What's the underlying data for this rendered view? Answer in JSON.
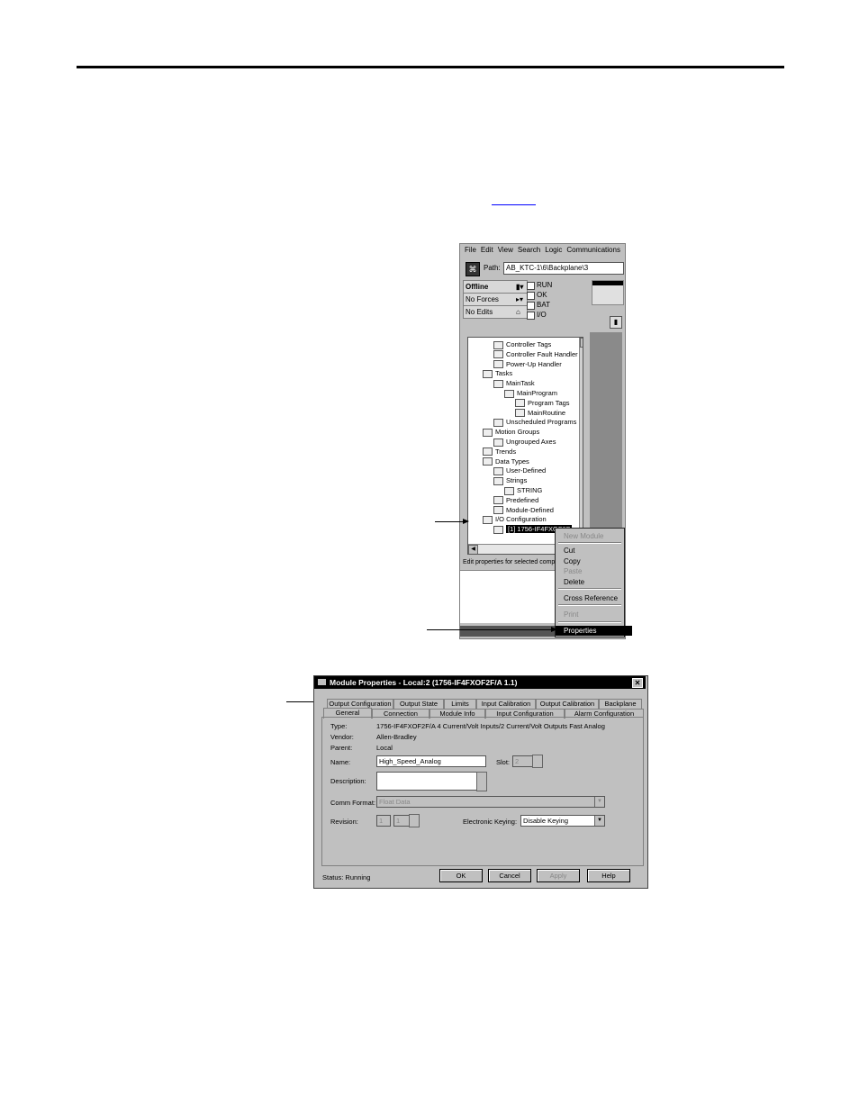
{
  "organizer": {
    "menu": [
      "File",
      "Edit",
      "View",
      "Search",
      "Logic",
      "Communications"
    ],
    "path_label": "Path:",
    "path_value": "AB_KTC-1\\6\\Backplane\\3",
    "status": [
      "Offline",
      "No Forces",
      "No Edits"
    ],
    "indicators": [
      "RUN",
      "OK",
      "BAT",
      "I/O"
    ],
    "tree": [
      {
        "text": "Controller Tags",
        "indent": 2
      },
      {
        "text": "Controller Fault Handler",
        "indent": 2
      },
      {
        "text": "Power-Up Handler",
        "indent": 2
      },
      {
        "text": "Tasks",
        "indent": 1
      },
      {
        "text": "MainTask",
        "indent": 2
      },
      {
        "text": "MainProgram",
        "indent": 3
      },
      {
        "text": "Program Tags",
        "indent": 4
      },
      {
        "text": "MainRoutine",
        "indent": 4
      },
      {
        "text": "Unscheduled Programs",
        "indent": 2
      },
      {
        "text": "Motion Groups",
        "indent": 1
      },
      {
        "text": "Ungrouped Axes",
        "indent": 2
      },
      {
        "text": "Trends",
        "indent": 1
      },
      {
        "text": "Data Types",
        "indent": 1
      },
      {
        "text": "User-Defined",
        "indent": 2
      },
      {
        "text": "Strings",
        "indent": 2
      },
      {
        "text": "STRING",
        "indent": 3
      },
      {
        "text": "Predefined",
        "indent": 2
      },
      {
        "text": "Module-Defined",
        "indent": 2
      },
      {
        "text": "I/O Configuration",
        "indent": 1
      },
      {
        "text": "[1] 1756-IF4FXOF2F",
        "indent": 2,
        "selected": true
      }
    ],
    "edit_status": "Edit properties for selected comp"
  },
  "context_menu": {
    "items": [
      {
        "label": "New Module",
        "disabled": true
      },
      {
        "label": "Cut",
        "disabled": false
      },
      {
        "label": "Copy",
        "disabled": false
      },
      {
        "label": "Paste",
        "disabled": true
      },
      {
        "label": "Delete",
        "disabled": false
      },
      {
        "label": "Cross Reference",
        "disabled": false
      },
      {
        "label": "Print",
        "disabled": true
      },
      {
        "label": "Properties",
        "disabled": false,
        "highlighted": true
      }
    ]
  },
  "module_properties": {
    "title": "Module Properties - Local:2 (1756-IF4FXOF2F/A 1.1)",
    "tabs_row1": [
      "Output Configuration",
      "Output State",
      "Limits",
      "Input Calibration",
      "Output Calibration",
      "Backplane"
    ],
    "tabs_row2": [
      "General",
      "Connection",
      "Module Info",
      "Input Configuration",
      "Alarm Configuration"
    ],
    "type_label": "Type:",
    "type_value": "1756-IF4FXOF2F/A 4 Current/Volt Inputs/2 Current/Volt Outputs Fast Analog",
    "vendor_label": "Vendor:",
    "vendor_value": "Allen-Bradley",
    "parent_label": "Parent:",
    "parent_value": "Local",
    "name_label": "Name:",
    "name_value": "High_Speed_Analog",
    "slot_label": "Slot:",
    "slot_value": "2",
    "description_label": "Description:",
    "comm_format_label": "Comm Format:",
    "comm_format_value": "Float Data",
    "revision_label": "Revision:",
    "revision_major": "1",
    "revision_minor": "1",
    "keying_label": "Electronic Keying:",
    "keying_value": "Disable Keying",
    "status_text": "Status:  Running",
    "buttons": {
      "ok": "OK",
      "cancel": "Cancel",
      "apply": "Apply",
      "help": "Help"
    }
  }
}
